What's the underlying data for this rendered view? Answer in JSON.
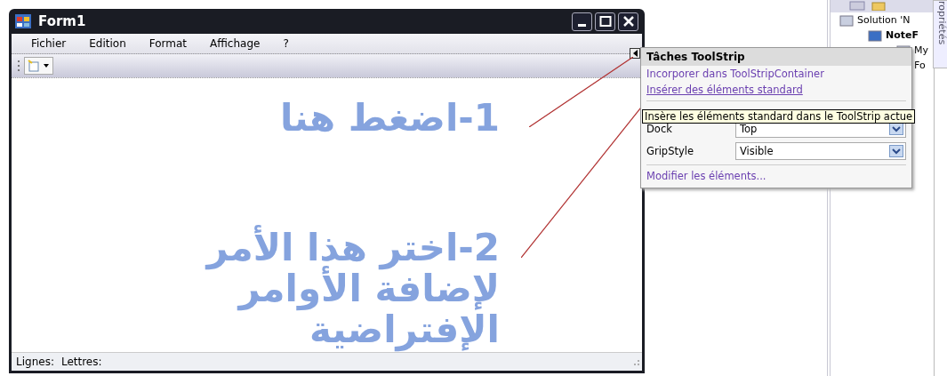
{
  "form": {
    "title": "Form1",
    "menu": [
      "Fichier",
      "Edition",
      "Format",
      "Affichage",
      "?"
    ],
    "status": [
      "Lignes:",
      "Lettres:"
    ]
  },
  "annotations": [
    {
      "text": "1-اضغط هنا"
    },
    {
      "text": "2-اختر هذا الأمر لإضافة الأوامر الإفتراضية"
    }
  ],
  "smart_tag": {
    "title": "Tâches ToolStrip",
    "links": [
      "Incorporer dans ToolStripContainer",
      "Insérer des éléments standard"
    ],
    "properties": [
      {
        "label": "Dock",
        "value": "Top"
      },
      {
        "label": "GripStyle",
        "value": "Visible"
      }
    ],
    "footer_link": "Modifier les éléments...",
    "tooltip": "Insère les éléments standard dans le ToolStrip actue"
  },
  "solution_explorer": {
    "side_tab": "ropriétés",
    "tree": [
      {
        "label": "Solution 'N",
        "children": [
          {
            "label": "NoteF",
            "children": [
              {
                "label": "My"
              },
              {
                "label": "Fo"
              }
            ]
          }
        ]
      }
    ]
  }
}
